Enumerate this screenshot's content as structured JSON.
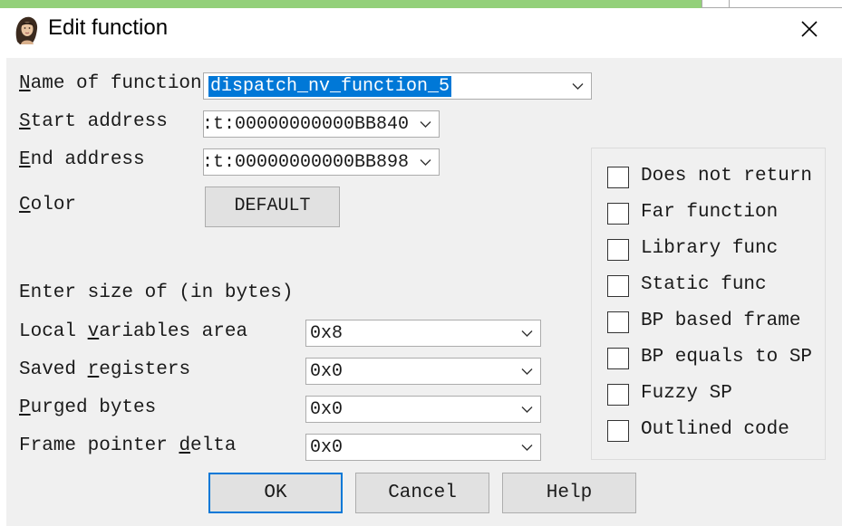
{
  "window": {
    "title": "Edit function",
    "icon": "app-portrait-icon",
    "close_icon": "close-icon"
  },
  "fields": {
    "name": {
      "label_u": "N",
      "label_rest": "ame of function",
      "value": "dispatch_nv_function_5"
    },
    "start": {
      "label_u": "S",
      "label_rest": "tart address",
      "value": ":t:00000000000BB840"
    },
    "end": {
      "label_u": "E",
      "label_rest": "nd address",
      "value": ":t:00000000000BB898"
    },
    "color": {
      "label_u": "C",
      "label_rest": "olor",
      "button_label": "DEFAULT"
    }
  },
  "size_section": {
    "heading": "Enter size of (in bytes)",
    "local": {
      "label_pre": "Local ",
      "label_u": "v",
      "label_rest": "ariables area",
      "value": "0x8"
    },
    "saved": {
      "label_pre": "Saved ",
      "label_u": "r",
      "label_rest": "egisters",
      "value": "0x0"
    },
    "purged": {
      "label_pre": "",
      "label_u": "P",
      "label_rest": "urged bytes",
      "value": "0x0"
    },
    "fpd": {
      "label_pre": "Frame pointer ",
      "label_u": "d",
      "label_rest": "elta",
      "value": "0x0"
    }
  },
  "flags": [
    {
      "label": "Does not return",
      "checked": false
    },
    {
      "label": "Far function",
      "checked": false
    },
    {
      "label": "Library func",
      "checked": false
    },
    {
      "label": "Static func",
      "checked": false
    },
    {
      "label": "BP based frame",
      "checked": false
    },
    {
      "label": "BP equals to SP",
      "checked": false
    },
    {
      "label": "Fuzzy SP",
      "checked": false
    },
    {
      "label": "Outlined code",
      "checked": false
    }
  ],
  "buttons": {
    "ok": "OK",
    "cancel": "Cancel",
    "help": "Help"
  },
  "colors": {
    "accent": "#0078d7",
    "panel": "#f0f0f0",
    "button": "#e1e1e1",
    "border": "#adadad"
  }
}
